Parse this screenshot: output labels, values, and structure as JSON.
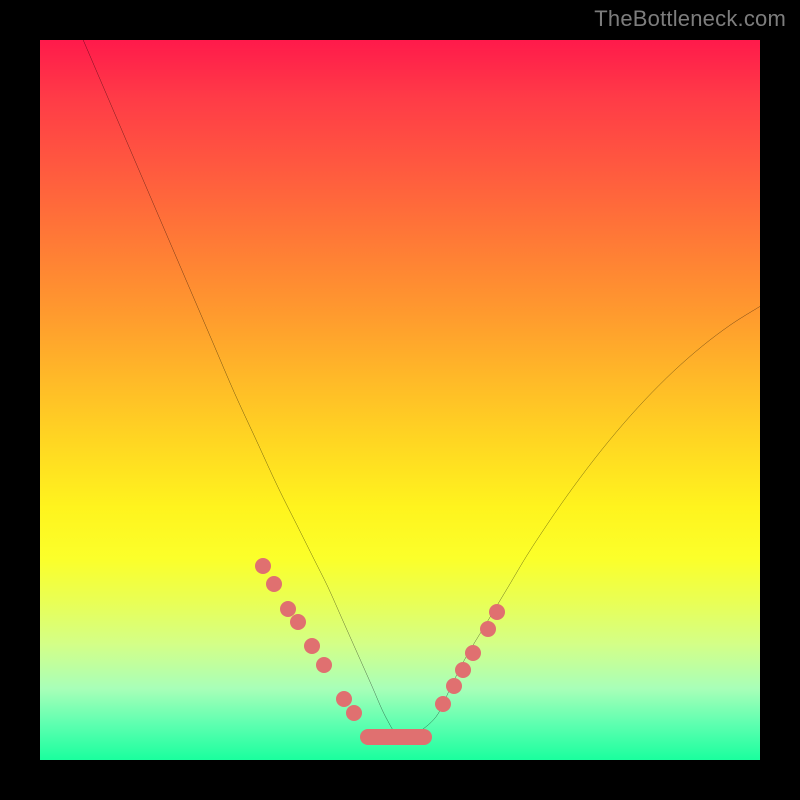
{
  "watermark": "TheBottleneck.com",
  "chart_data": {
    "type": "line",
    "title": "",
    "xlabel": "",
    "ylabel": "",
    "xlim": [
      0,
      100
    ],
    "ylim": [
      0,
      100
    ],
    "grid": false,
    "legend": false,
    "series": [
      {
        "name": "curve",
        "color": "#000000",
        "x": [
          6,
          9,
          12,
          15,
          18,
          21,
          24,
          27,
          30,
          33,
          36,
          38,
          40,
          42,
          44,
          46,
          48,
          50,
          52,
          55,
          57,
          59,
          62,
          65,
          68,
          72,
          76,
          80,
          84,
          88,
          92,
          96,
          100
        ],
        "y": [
          100,
          93,
          86,
          79,
          72,
          65,
          58,
          51,
          44.5,
          38,
          32,
          28,
          24,
          19.5,
          15,
          10.5,
          6,
          3,
          3.5,
          6,
          10,
          14,
          19,
          24,
          29,
          35,
          40.5,
          45.5,
          50,
          54,
          57.5,
          60.5,
          63
        ]
      }
    ],
    "markers": {
      "name": "dots",
      "color": "#e07070",
      "x": [
        31.0,
        32.5,
        34.5,
        35.8,
        37.8,
        39.5,
        42.2,
        43.6,
        56.0,
        57.5,
        58.8,
        60.2,
        62.2,
        63.5
      ],
      "y": [
        27.0,
        24.5,
        21.0,
        19.2,
        15.8,
        13.2,
        8.5,
        6.5,
        7.8,
        10.3,
        12.5,
        14.8,
        18.2,
        20.5
      ]
    },
    "floor_bar": {
      "name": "bottom-bar",
      "color": "#e07070",
      "x_start": 44.5,
      "x_end": 54.5,
      "y": 3.2
    }
  }
}
